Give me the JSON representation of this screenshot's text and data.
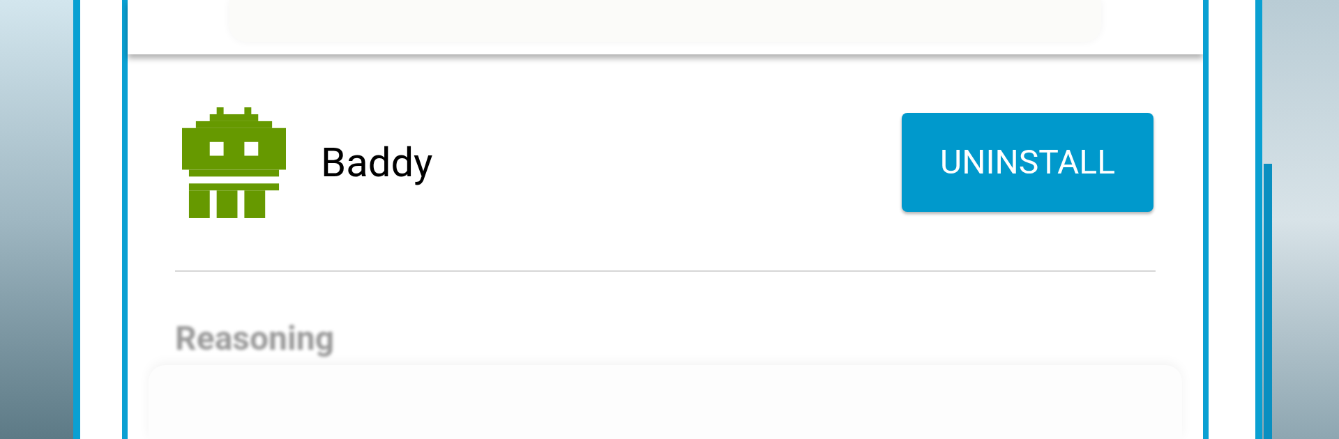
{
  "app": {
    "name": "Baddy",
    "action": "UNINSTALL"
  },
  "section": {
    "heading": "Reasoning"
  }
}
